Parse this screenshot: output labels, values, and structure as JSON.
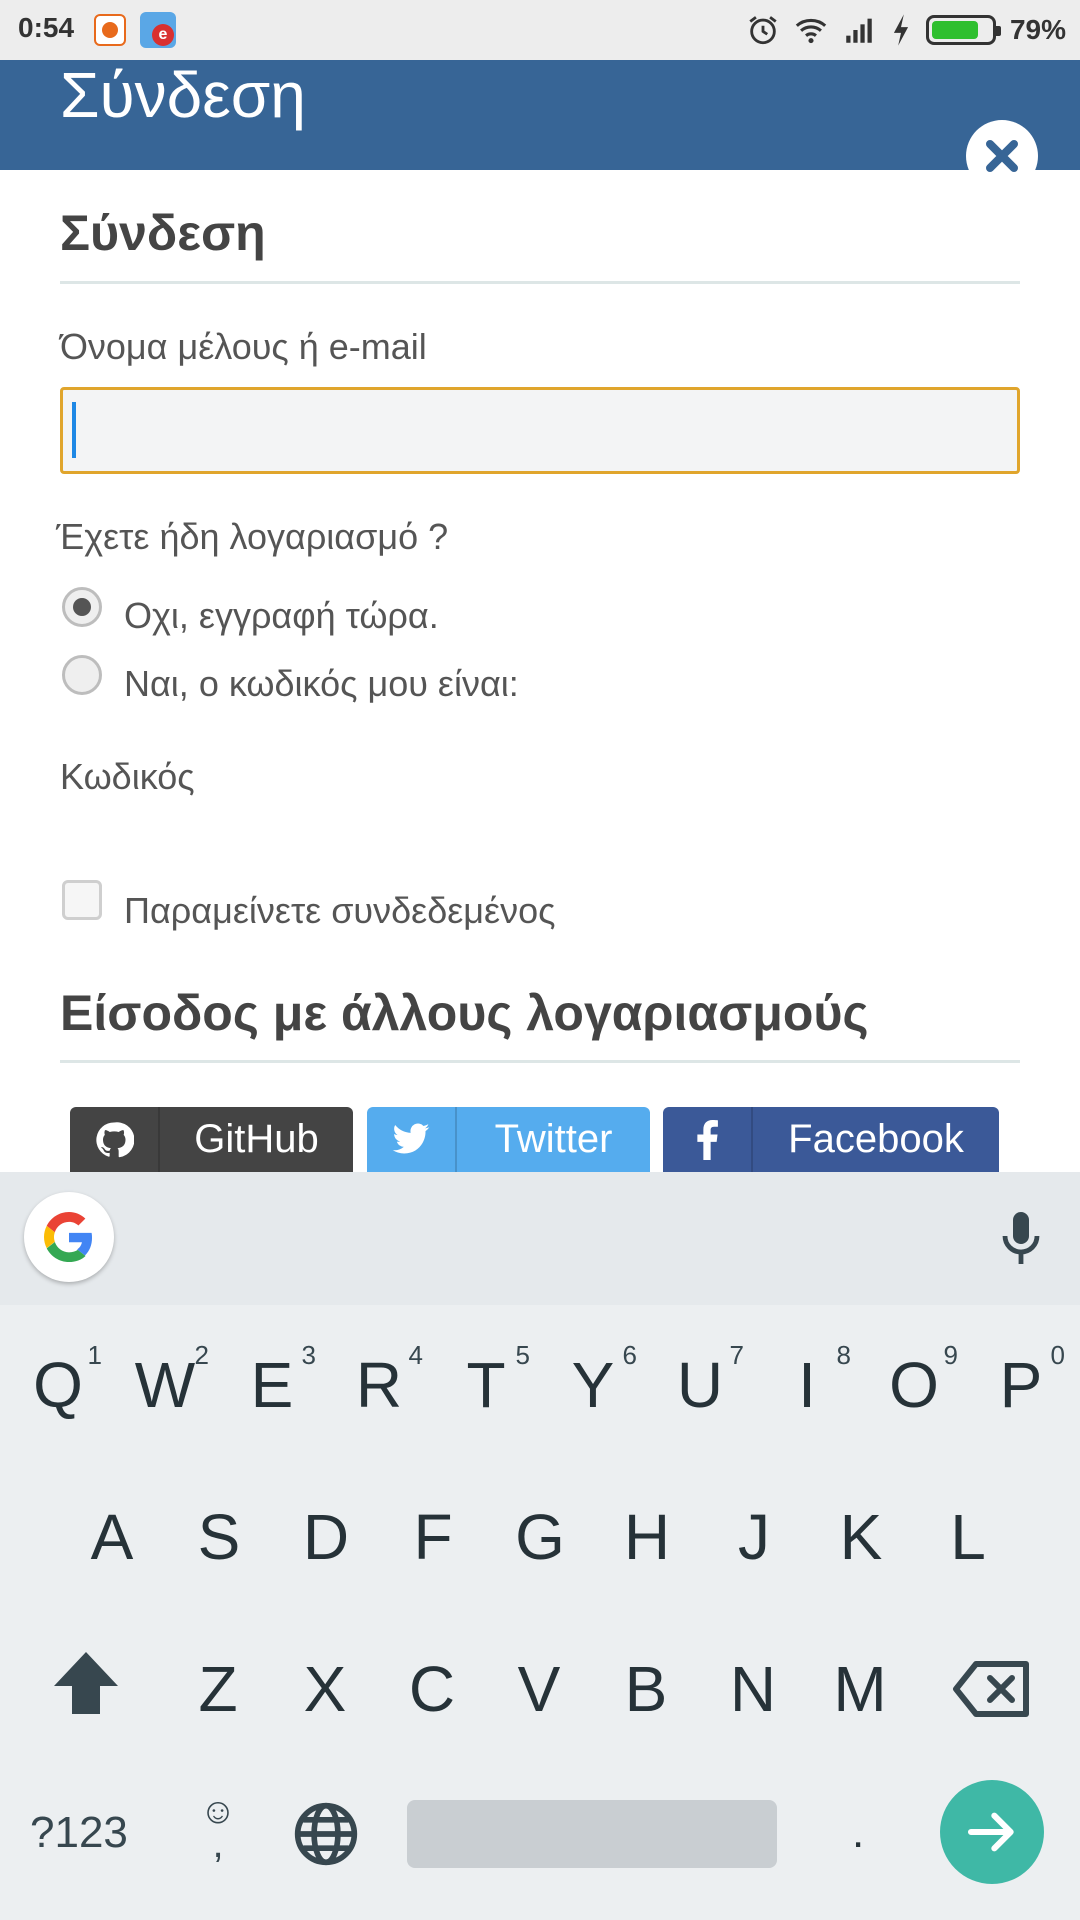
{
  "status_bar": {
    "time": "0:54",
    "battery_percent_text": "79%",
    "battery_level": 0.79,
    "icons": [
      "notification-app-icon",
      "email-app-icon",
      "alarm-icon",
      "wifi-icon",
      "signal-icon",
      "charging-icon",
      "battery-icon"
    ]
  },
  "header": {
    "title": "Σύνδεση",
    "close_icon": "close-icon"
  },
  "form": {
    "section_title": "Σύνδεση",
    "username_label": "Όνομα μέλους ή e-mail",
    "username_value": "",
    "account_question": "Έχετε ήδη λογαριασμό ?",
    "radio_no_label": "Οχι, εγγραφή τώρα.",
    "radio_yes_label": "Ναι, ο κωδικός μου είναι:",
    "radio_selected": "no",
    "password_label": "Κωδικός",
    "remember_label": "Παραμείνετε συνδεδεμένος",
    "remember_checked": false,
    "other_accounts_title": "Είσοδος με άλλους λογαριασμούς",
    "social": [
      {
        "label": "GitHub",
        "icon": "github-icon",
        "color": "#444444"
      },
      {
        "label": "Twitter",
        "icon": "twitter-icon",
        "color": "#55acee"
      },
      {
        "label": "Facebook",
        "icon": "facebook-icon",
        "color": "#3b5998"
      }
    ],
    "accent_color": "#e0a52c",
    "header_color": "#376596"
  },
  "keyboard": {
    "row1": [
      {
        "key": "Q",
        "hint": "1"
      },
      {
        "key": "W",
        "hint": "2"
      },
      {
        "key": "E",
        "hint": "3"
      },
      {
        "key": "R",
        "hint": "4"
      },
      {
        "key": "T",
        "hint": "5"
      },
      {
        "key": "Y",
        "hint": "6"
      },
      {
        "key": "U",
        "hint": "7"
      },
      {
        "key": "I",
        "hint": "8"
      },
      {
        "key": "O",
        "hint": "9"
      },
      {
        "key": "P",
        "hint": "0"
      }
    ],
    "row2": [
      "A",
      "S",
      "D",
      "F",
      "G",
      "H",
      "J",
      "K",
      "L"
    ],
    "row3": [
      "Z",
      "X",
      "C",
      "V",
      "B",
      "N",
      "M"
    ],
    "symbols_label": "?123",
    "emoji_label": "☺",
    "comma_label": ",",
    "period_label": ".",
    "enter_color": "#3fb8a6"
  }
}
